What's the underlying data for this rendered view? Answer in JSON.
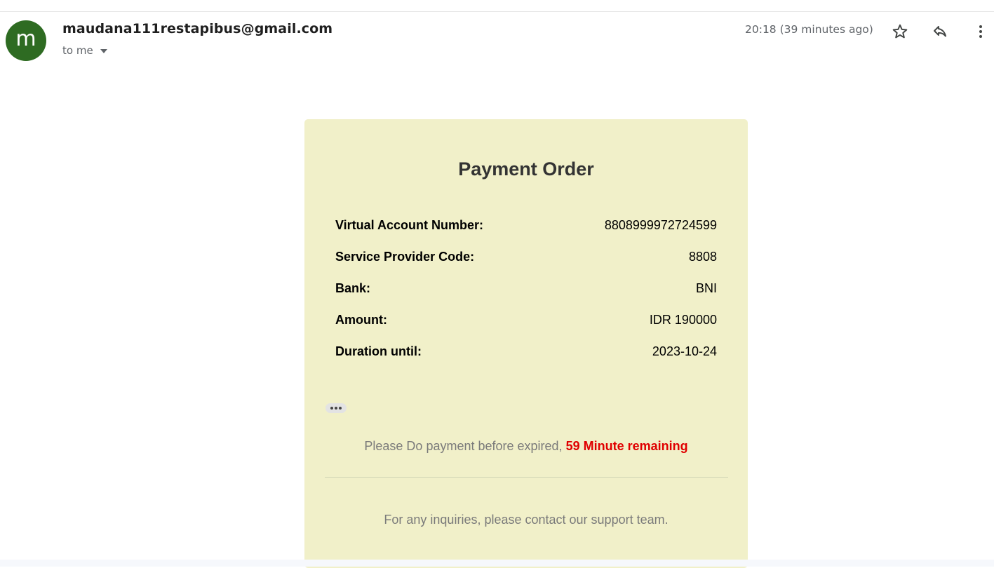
{
  "email": {
    "avatar_letter": "m",
    "sender": "maudana111restapibus@gmail.com",
    "recipient_label": "to me",
    "timestamp": "20:18 (39 minutes ago)",
    "actions": {
      "star_icon": "star-icon",
      "reply_icon": "reply-icon",
      "more_icon": "more-vertical-icon"
    }
  },
  "payment": {
    "title": "Payment Order",
    "rows": [
      {
        "label": "Virtual Account Number:",
        "value": "8808999972724599"
      },
      {
        "label": "Service Provider Code:",
        "value": "8808"
      },
      {
        "label": "Bank:",
        "value": "BNI"
      },
      {
        "label": "Amount:",
        "value": "IDR 190000"
      },
      {
        "label": "Duration until:",
        "value": "2023-10-24"
      }
    ],
    "notice_text": "Please Do payment before expired, ",
    "remaining_text": "59 Minute remaining",
    "support_text": "For any inquiries, please contact our support team."
  },
  "colors": {
    "avatar_bg": "#2e6b22",
    "card_bg": "#f1f0c9",
    "remaining_red": "#e00000"
  }
}
